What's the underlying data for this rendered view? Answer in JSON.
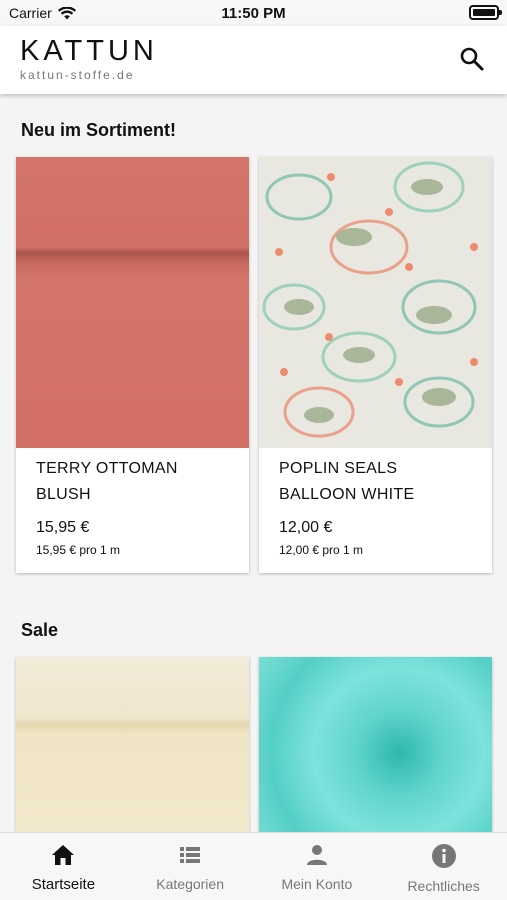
{
  "status": {
    "carrier": "Carrier",
    "time": "11:50 PM"
  },
  "header": {
    "brand": "KATTUN",
    "domain": "kattun-stoffe.de"
  },
  "sections": [
    {
      "title": "Neu im Sortiment!",
      "products": [
        {
          "name": "TERRY OTTOMAN BLUSH",
          "price": "15,95 €",
          "unit_price": "15,95 € pro 1 m"
        },
        {
          "name": "POPLIN SEALS BALLOON WHITE",
          "price": "12,00 €",
          "unit_price": "12,00 € pro 1 m"
        }
      ]
    },
    {
      "title": "Sale"
    }
  ],
  "nav": [
    {
      "label": "Startseite",
      "icon": "home-icon"
    },
    {
      "label": "Kategorien",
      "icon": "list-icon"
    },
    {
      "label": "Mein Konto",
      "icon": "person-icon"
    },
    {
      "label": "Rechtliches",
      "icon": "info-icon"
    }
  ],
  "colors": {
    "accent": "#111111",
    "inactive": "#777777"
  }
}
